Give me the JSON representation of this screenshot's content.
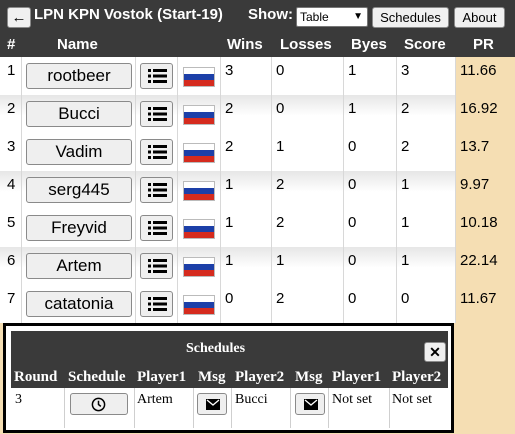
{
  "header": {
    "back_icon": "←",
    "title": "LPN KPN Vostok (Start-19)",
    "show_label": "Show:",
    "show_value": "Table",
    "schedules_btn": "Schedules",
    "about_btn": "About"
  },
  "columns": [
    "#",
    "Name",
    "Wins",
    "Losses",
    "Byes",
    "Score",
    "PR"
  ],
  "rows": [
    {
      "n": "1",
      "name": "rootbeer",
      "wins": "3",
      "losses": "0",
      "byes": "1",
      "score": "3",
      "pr": "11.66"
    },
    {
      "n": "2",
      "name": "Bucci",
      "wins": "2",
      "losses": "0",
      "byes": "1",
      "score": "2",
      "pr": "16.92"
    },
    {
      "n": "3",
      "name": "Vadim",
      "wins": "2",
      "losses": "1",
      "byes": "0",
      "score": "2",
      "pr": "13.7"
    },
    {
      "n": "4",
      "name": "serg445",
      "wins": "1",
      "losses": "2",
      "byes": "0",
      "score": "1",
      "pr": "9.97"
    },
    {
      "n": "5",
      "name": "Freyvid",
      "wins": "1",
      "losses": "2",
      "byes": "0",
      "score": "1",
      "pr": "10.18"
    },
    {
      "n": "6",
      "name": "Artem",
      "wins": "1",
      "losses": "1",
      "byes": "0",
      "score": "1",
      "pr": "22.14"
    },
    {
      "n": "7",
      "name": "catatonia",
      "wins": "0",
      "losses": "2",
      "byes": "0",
      "score": "0",
      "pr": "11.67"
    }
  ],
  "flag_colors": [
    "#ffffff",
    "#1c3fa8",
    "#d52b1e"
  ],
  "schedules": {
    "title": "Schedules",
    "close": "✕",
    "columns": [
      "Round",
      "Schedule",
      "Player1",
      "Msg",
      "Player2",
      "Msg",
      "Player1",
      "Player2"
    ],
    "row": {
      "round": "3",
      "player1": "Artem",
      "player2": "Bucci",
      "p1_status": "Not set",
      "p2_status": "Not set"
    }
  },
  "colors": {
    "header_bg": "#3a3a3a",
    "pr_bg": "#f5deb3"
  }
}
